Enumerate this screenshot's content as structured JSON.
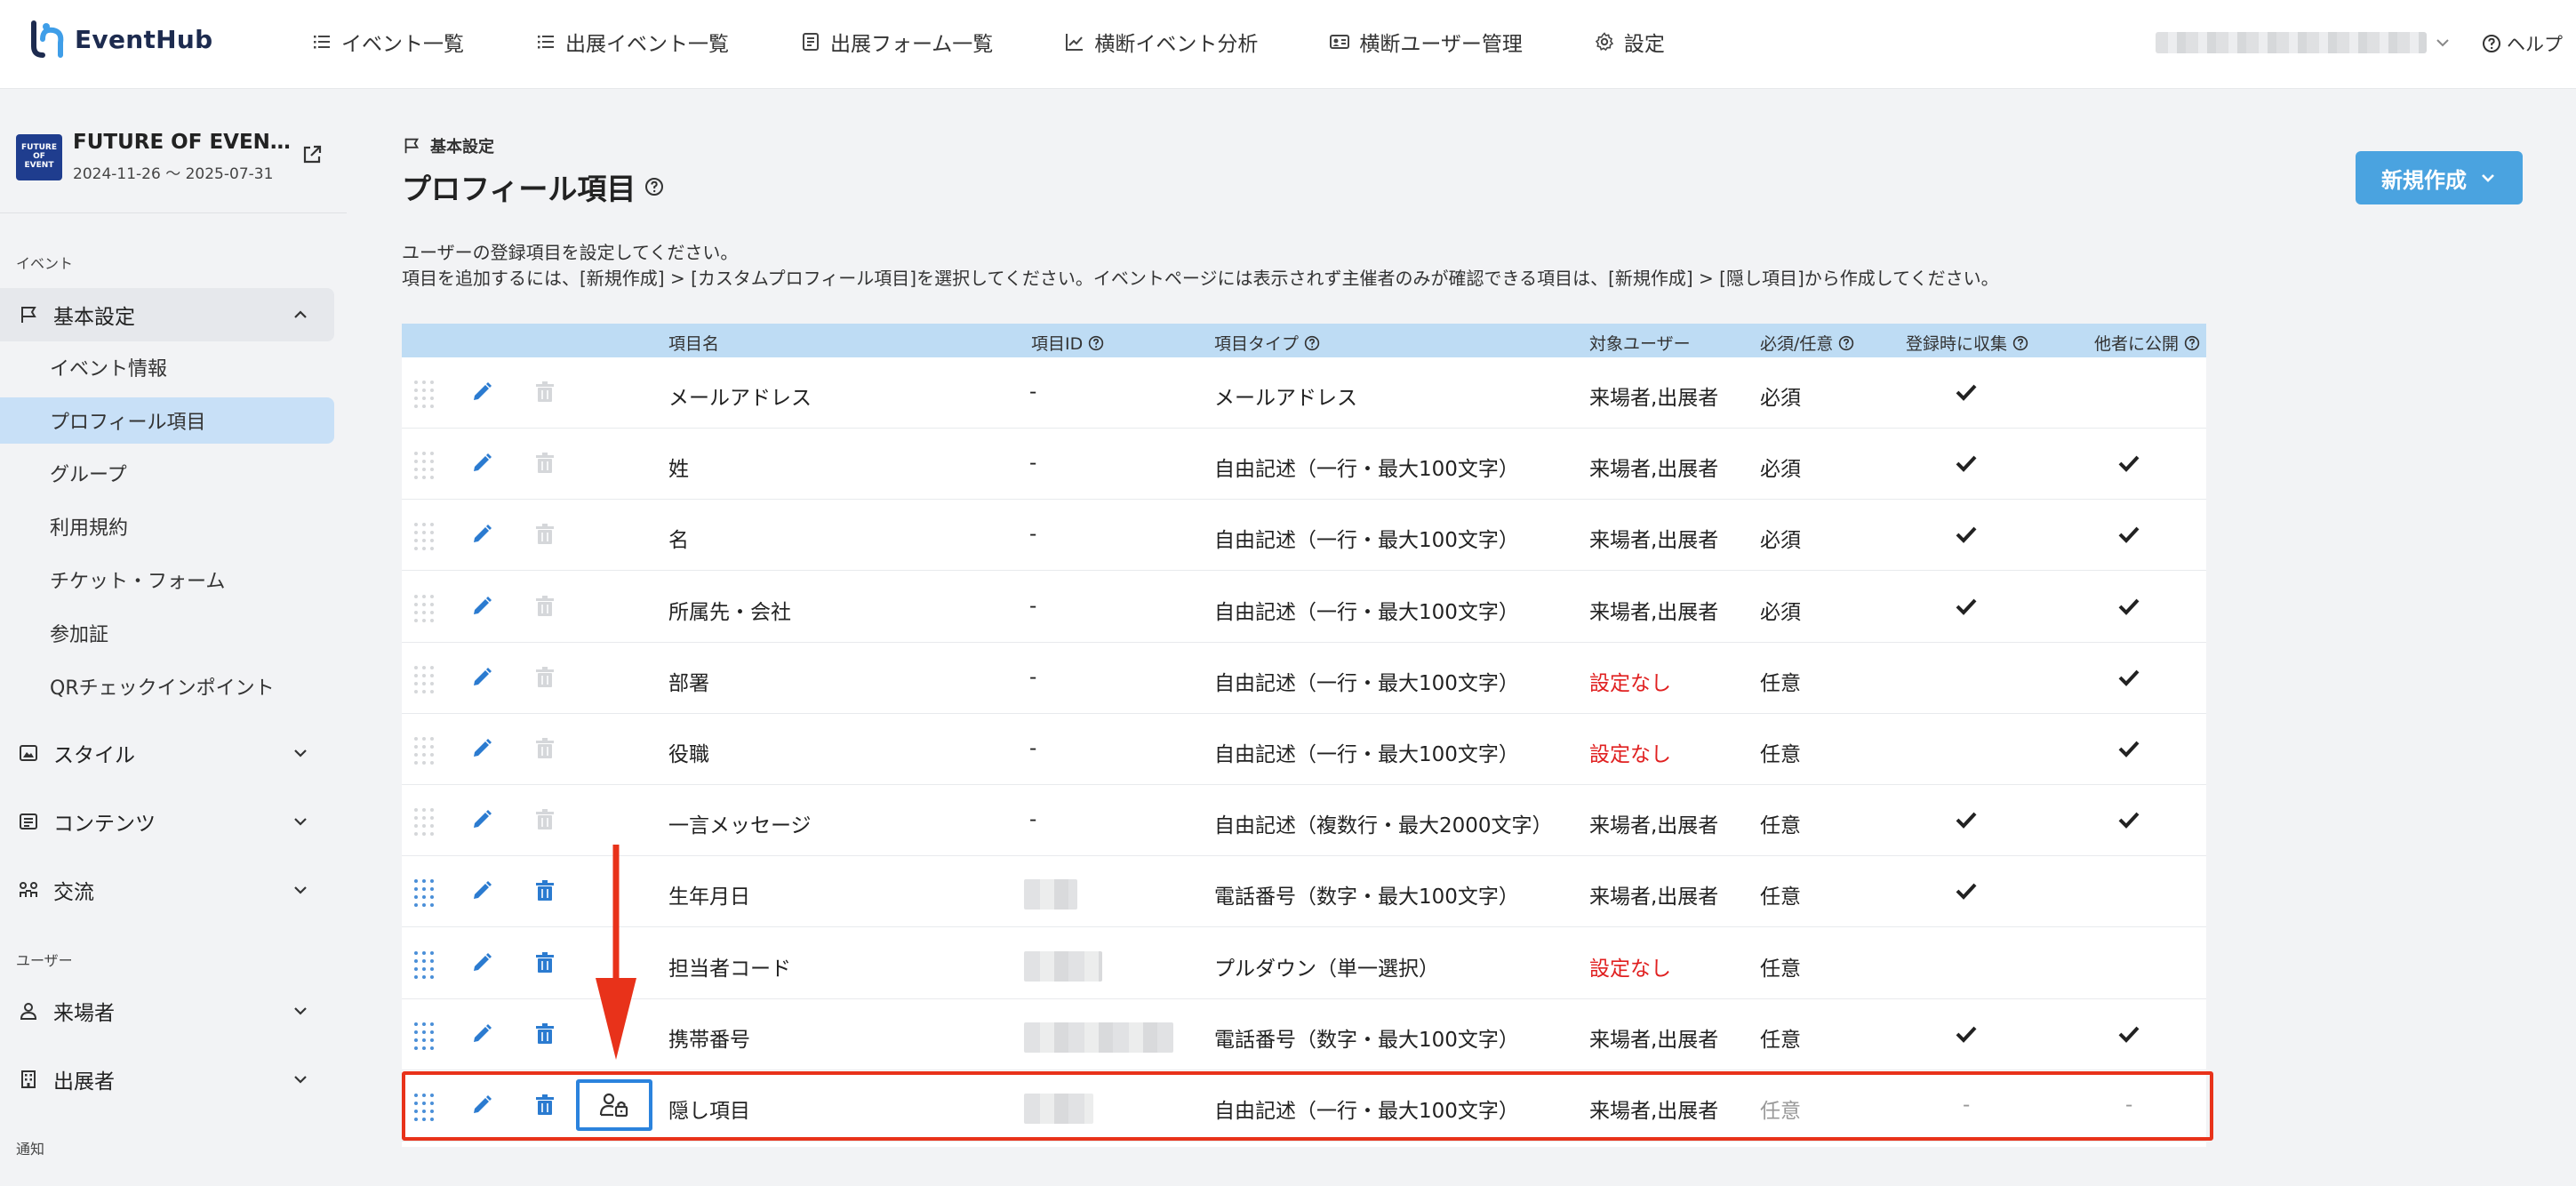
{
  "app": {
    "brand": "EventHub",
    "nav": [
      {
        "label": "イベント一覧",
        "icon": "list-icon"
      },
      {
        "label": "出展イベント一覧",
        "icon": "list-icon"
      },
      {
        "label": "出展フォーム一覧",
        "icon": "form-icon"
      },
      {
        "label": "横断イベント分析",
        "icon": "chart-icon"
      },
      {
        "label": "横断ユーザー管理",
        "icon": "user-card-icon"
      },
      {
        "label": "設定",
        "icon": "gear-icon"
      }
    ],
    "help": "ヘルプ"
  },
  "sidebar": {
    "event_title": "FUTURE OF EVEN…",
    "event_dates": "2024-11-26 ～ 2025-07-31",
    "event_logo": "FUTURE OF EVENT",
    "section_event": "イベント",
    "section_user": "ユーザー",
    "section_notice": "通知",
    "groups": {
      "basic": "基本設定",
      "style": "スタイル",
      "content": "コンテンツ",
      "exchange": "交流",
      "visitor": "来場者",
      "exhibitor": "出展者"
    },
    "sub": [
      "イベント情報",
      "プロフィール項目",
      "グループ",
      "利用規約",
      "チケット・フォーム",
      "参加証",
      "QRチェックインポイント"
    ]
  },
  "main": {
    "breadcrumb": "基本設定",
    "title": "プロフィール項目",
    "new_button": "新規作成",
    "desc1": "ユーザーの登録項目を設定してください。",
    "desc2": "項目を追加するには、[新規作成] > [カスタムプロフィール項目]を選択してください。イベントページには表示されず主催者のみが確認できる項目は、[新規作成] > [隠し項目]から作成してください。"
  },
  "table": {
    "headers": {
      "name": "項目名",
      "id": "項目ID",
      "type": "項目タイプ",
      "target": "対象ユーザー",
      "required": "必須/任意",
      "collect": "登録時に収集",
      "public": "他者に公開"
    },
    "rows": [
      {
        "name": "メールアドレス",
        "id": "-",
        "type": "メールアドレス",
        "target": "来場者,出展者",
        "required": "必須",
        "collect": true,
        "public": false
      },
      {
        "name": "姓",
        "id": "-",
        "type": "自由記述（一行・最大100文字）",
        "target": "来場者,出展者",
        "required": "必須",
        "collect": true,
        "public": true
      },
      {
        "name": "名",
        "id": "-",
        "type": "自由記述（一行・最大100文字）",
        "target": "来場者,出展者",
        "required": "必須",
        "collect": true,
        "public": true
      },
      {
        "name": "所属先・会社",
        "id": "-",
        "type": "自由記述（一行・最大100文字）",
        "target": "来場者,出展者",
        "required": "必須",
        "collect": true,
        "public": true
      },
      {
        "name": "部署",
        "id": "-",
        "type": "自由記述（一行・最大100文字）",
        "target": "設定なし",
        "required": "任意",
        "collect": false,
        "public": true
      },
      {
        "name": "役職",
        "id": "-",
        "type": "自由記述（一行・最大100文字）",
        "target": "設定なし",
        "required": "任意",
        "collect": false,
        "public": true
      },
      {
        "name": "一言メッセージ",
        "id": "-",
        "type": "自由記述（複数行・最大2000文字）",
        "target": "来場者,出展者",
        "required": "任意",
        "collect": true,
        "public": true
      },
      {
        "name": "生年月日",
        "id": "",
        "type": "電話番号（数字・最大100文字）",
        "target": "来場者,出展者",
        "required": "任意",
        "collect": true,
        "public": false
      },
      {
        "name": "担当者コード",
        "id": "",
        "type": "プルダウン（単一選択）",
        "target": "設定なし",
        "required": "任意",
        "collect": false,
        "public": false
      },
      {
        "name": "携帯番号",
        "id": "",
        "type": "電話番号（数字・最大100文字）",
        "target": "来場者,出展者",
        "required": "任意",
        "collect": true,
        "public": true
      },
      {
        "name": "隠し項目",
        "id": "",
        "type": "自由記述（一行・最大100文字）",
        "target": "来場者,出展者",
        "required": "任意",
        "collect_text": "-",
        "public_text": "-"
      }
    ]
  },
  "colors": {
    "accent": "#4aa3e0",
    "header_bg": "#bedcf4",
    "highlight": "#e8321a",
    "active_nav": "#c8e0f7"
  }
}
